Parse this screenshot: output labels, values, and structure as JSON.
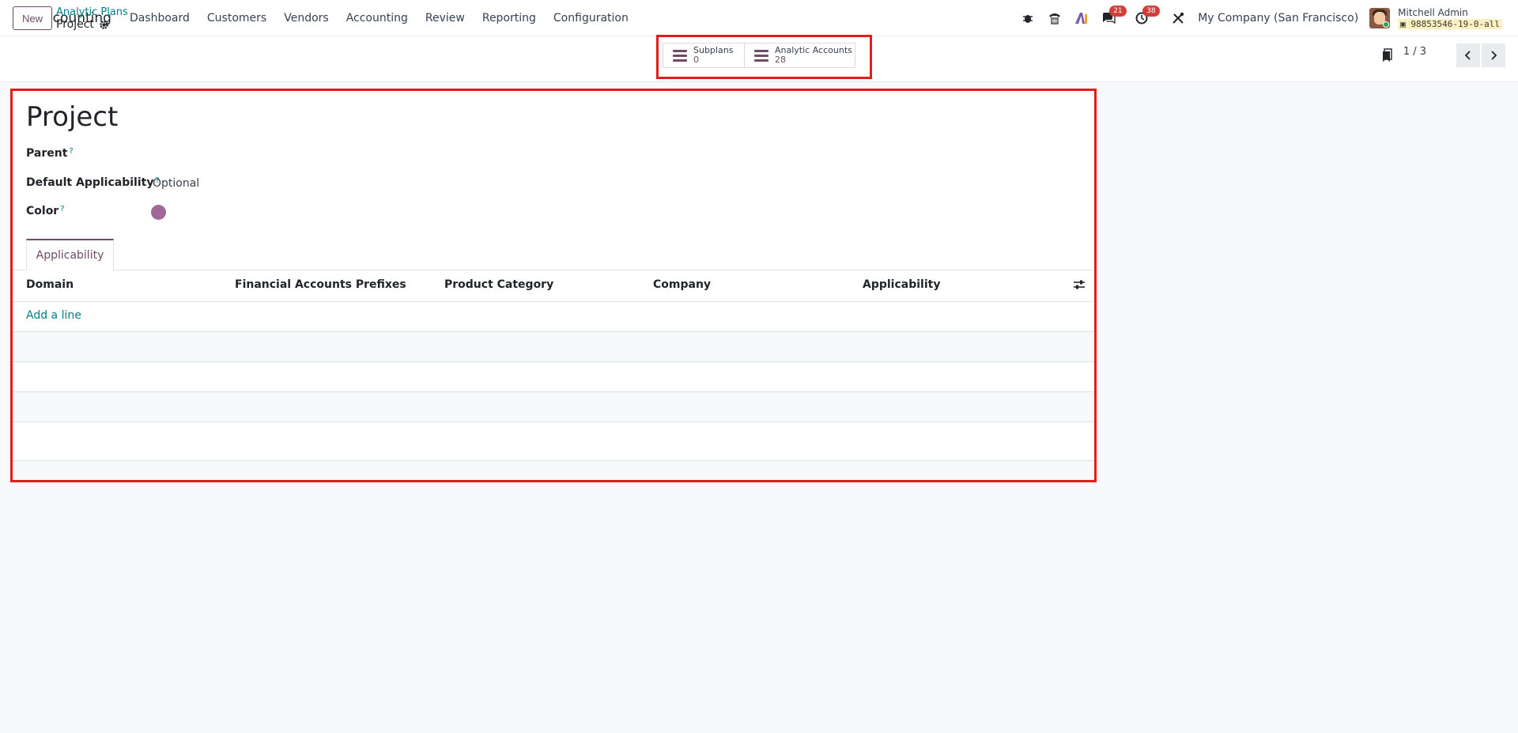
{
  "app": {
    "name": "Accounting"
  },
  "menu": [
    "Dashboard",
    "Customers",
    "Vendors",
    "Accounting",
    "Review",
    "Reporting",
    "Configuration"
  ],
  "systray": {
    "messages_count": "21",
    "activities_count": "38",
    "company": "My Company (San Francisco)",
    "user_name": "Mitchell Admin",
    "db_name": "98853546-19-0-all"
  },
  "control": {
    "new_label": "New",
    "breadcrumb_parent": "Analytic Plans",
    "breadcrumb_current": "Project",
    "smart_buttons": [
      {
        "label": "Subplans",
        "count": "0"
      },
      {
        "label": "Analytic Accounts",
        "count": "28"
      }
    ],
    "pager": "1 / 3"
  },
  "form": {
    "title": "Project",
    "fields": {
      "parent_label": "Parent",
      "applicability_label": "Default Applicability",
      "applicability_value": "Optional",
      "color_label": "Color",
      "help_mark": "?"
    },
    "color_value": "#a0699a",
    "tab": "Applicability",
    "table": {
      "columns": [
        "Domain",
        "Financial Accounts Prefixes",
        "Product Category",
        "Company",
        "Applicability"
      ],
      "add_line": "Add a line"
    }
  }
}
